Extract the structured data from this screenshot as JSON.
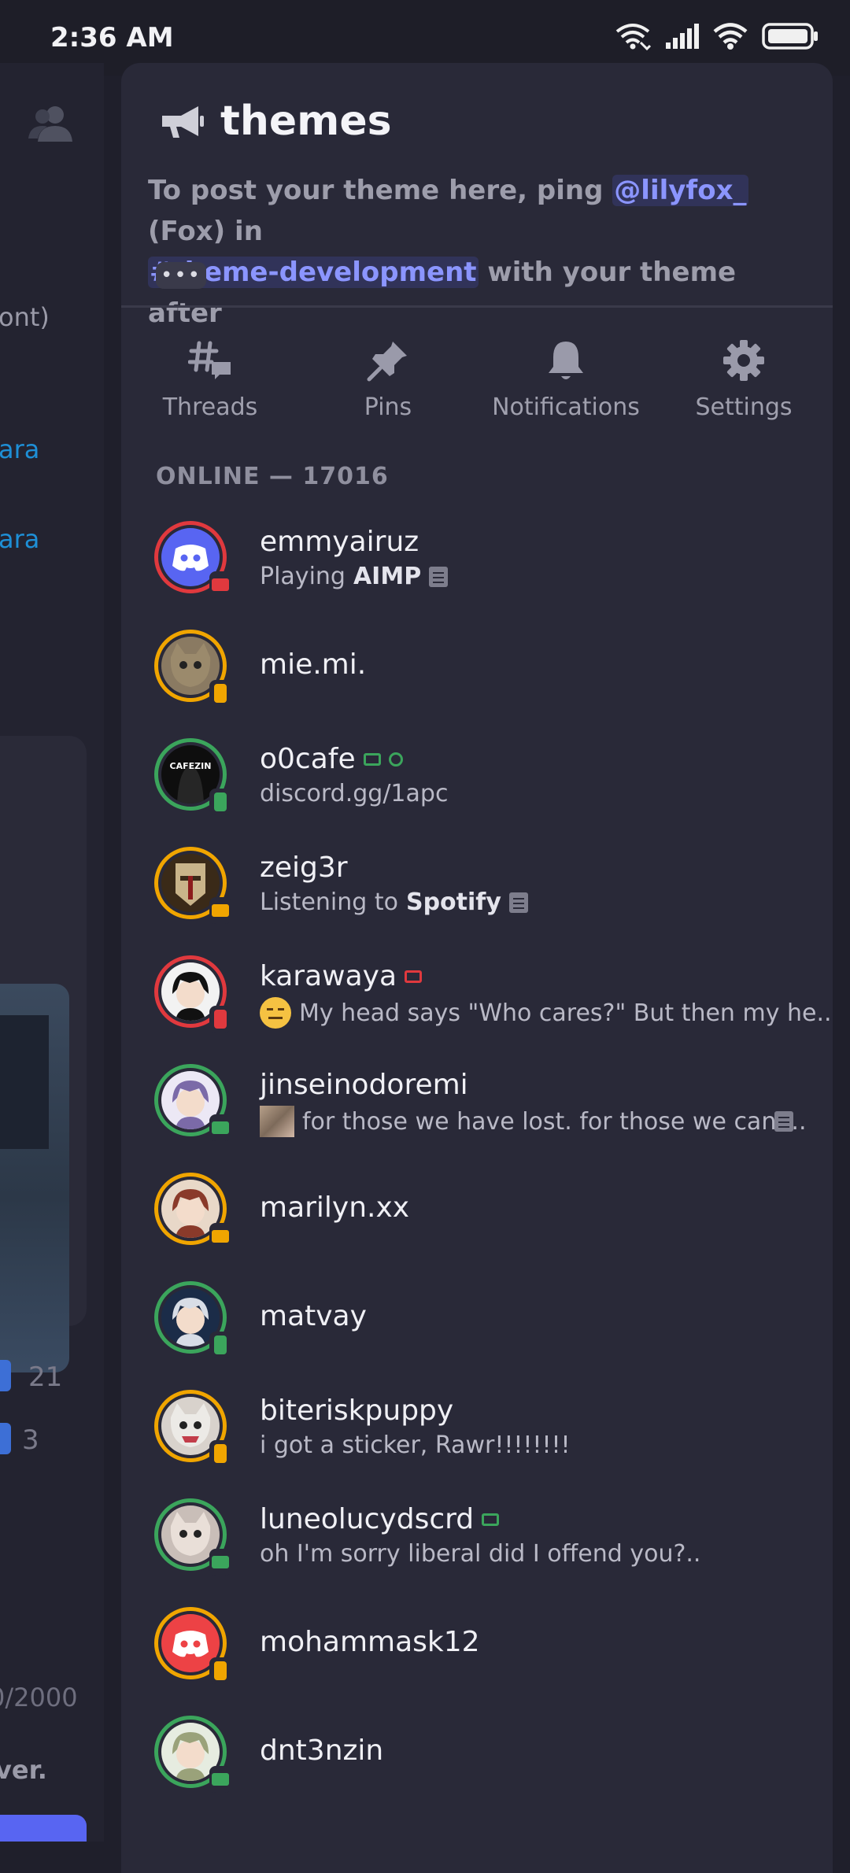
{
  "status_bar": {
    "time": "2:36 AM"
  },
  "left_panel": {
    "partial_texts": [
      "ont)",
      "ara",
      "ara",
      "21",
      "3",
      "0/2000",
      "ver."
    ]
  },
  "channel": {
    "name": "themes",
    "topic_part1": "To post your theme here, ping ",
    "topic_mention": "@lilyfox_",
    "topic_part2": " (Fox) in",
    "topic_channel": "#theme-development",
    "topic_part3": " with your theme after",
    "more": "•••"
  },
  "actions": [
    {
      "label": "Threads",
      "icon": "threads-icon"
    },
    {
      "label": "Pins",
      "icon": "pin-icon"
    },
    {
      "label": "Notifications",
      "icon": "bell-icon"
    },
    {
      "label": "Settings",
      "icon": "gear-icon"
    }
  ],
  "members_header": "ONLINE — 17016",
  "members": [
    {
      "name": "emmyairuz",
      "status_prefix": "Playing ",
      "status_bold": "AIMP",
      "ring": "#e0393e",
      "platform": "desktop",
      "platform_color": "#e0393e",
      "avatar": "discord-logo"
    },
    {
      "name": "mie.mi.",
      "ring": "#f0a500",
      "platform": "mobile",
      "platform_color": "#f0a500",
      "avatar": "cat"
    },
    {
      "name": "o0cafe",
      "status_prefix": "discord.gg/1apc",
      "ring": "#3ba55c",
      "platform": "mobile",
      "platform_color": "#3ba55c",
      "avatar": "cafezin",
      "avatar_text": "CAFEZIN"
    },
    {
      "name": "zeig3r",
      "status_prefix": "Listening to ",
      "status_bold": "Spotify",
      "ring": "#f0a500",
      "platform": "desktop",
      "platform_color": "#f0a500",
      "avatar": "knight"
    },
    {
      "name": "karawaya",
      "status_prefix": "My head says \"Who cares?\" But then my he...",
      "ring": "#e0393e",
      "platform": "mobile",
      "platform_color": "#e0393e",
      "avatar": "anime"
    },
    {
      "name": "jinseinodoremi",
      "status_prefix": "for those we have lost. for those we can ...",
      "ring": "#3ba55c",
      "platform": "desktop",
      "platform_color": "#3ba55c",
      "avatar": "anime-purple"
    },
    {
      "name": "marilyn.xx",
      "ring": "#f0a500",
      "platform": "desktop",
      "platform_color": "#f0a500",
      "avatar": "anime-red"
    },
    {
      "name": "matvay",
      "ring": "#3ba55c",
      "platform": "mobile",
      "platform_color": "#3ba55c",
      "avatar": "anime-blue"
    },
    {
      "name": "biteriskpuppy",
      "status_prefix": "i got a sticker, Rawr!!!!!!!!",
      "ring": "#f0a500",
      "platform": "mobile",
      "platform_color": "#f0a500",
      "avatar": "wolf"
    },
    {
      "name": "luneolucydscrd",
      "status_prefix": "oh I'm sorry liberal did I offend you?..",
      "ring": "#3ba55c",
      "platform": "desktop",
      "platform_color": "#3ba55c",
      "avatar": "cat-white"
    },
    {
      "name": "mohammask12",
      "ring": "#f0a500",
      "platform": "mobile",
      "platform_color": "#f0a500",
      "avatar": "discord-red"
    },
    {
      "name": "dnt3nzin",
      "ring": "#3ba55c",
      "platform": "desktop",
      "platform_color": "#3ba55c",
      "avatar": "anime-green"
    }
  ]
}
